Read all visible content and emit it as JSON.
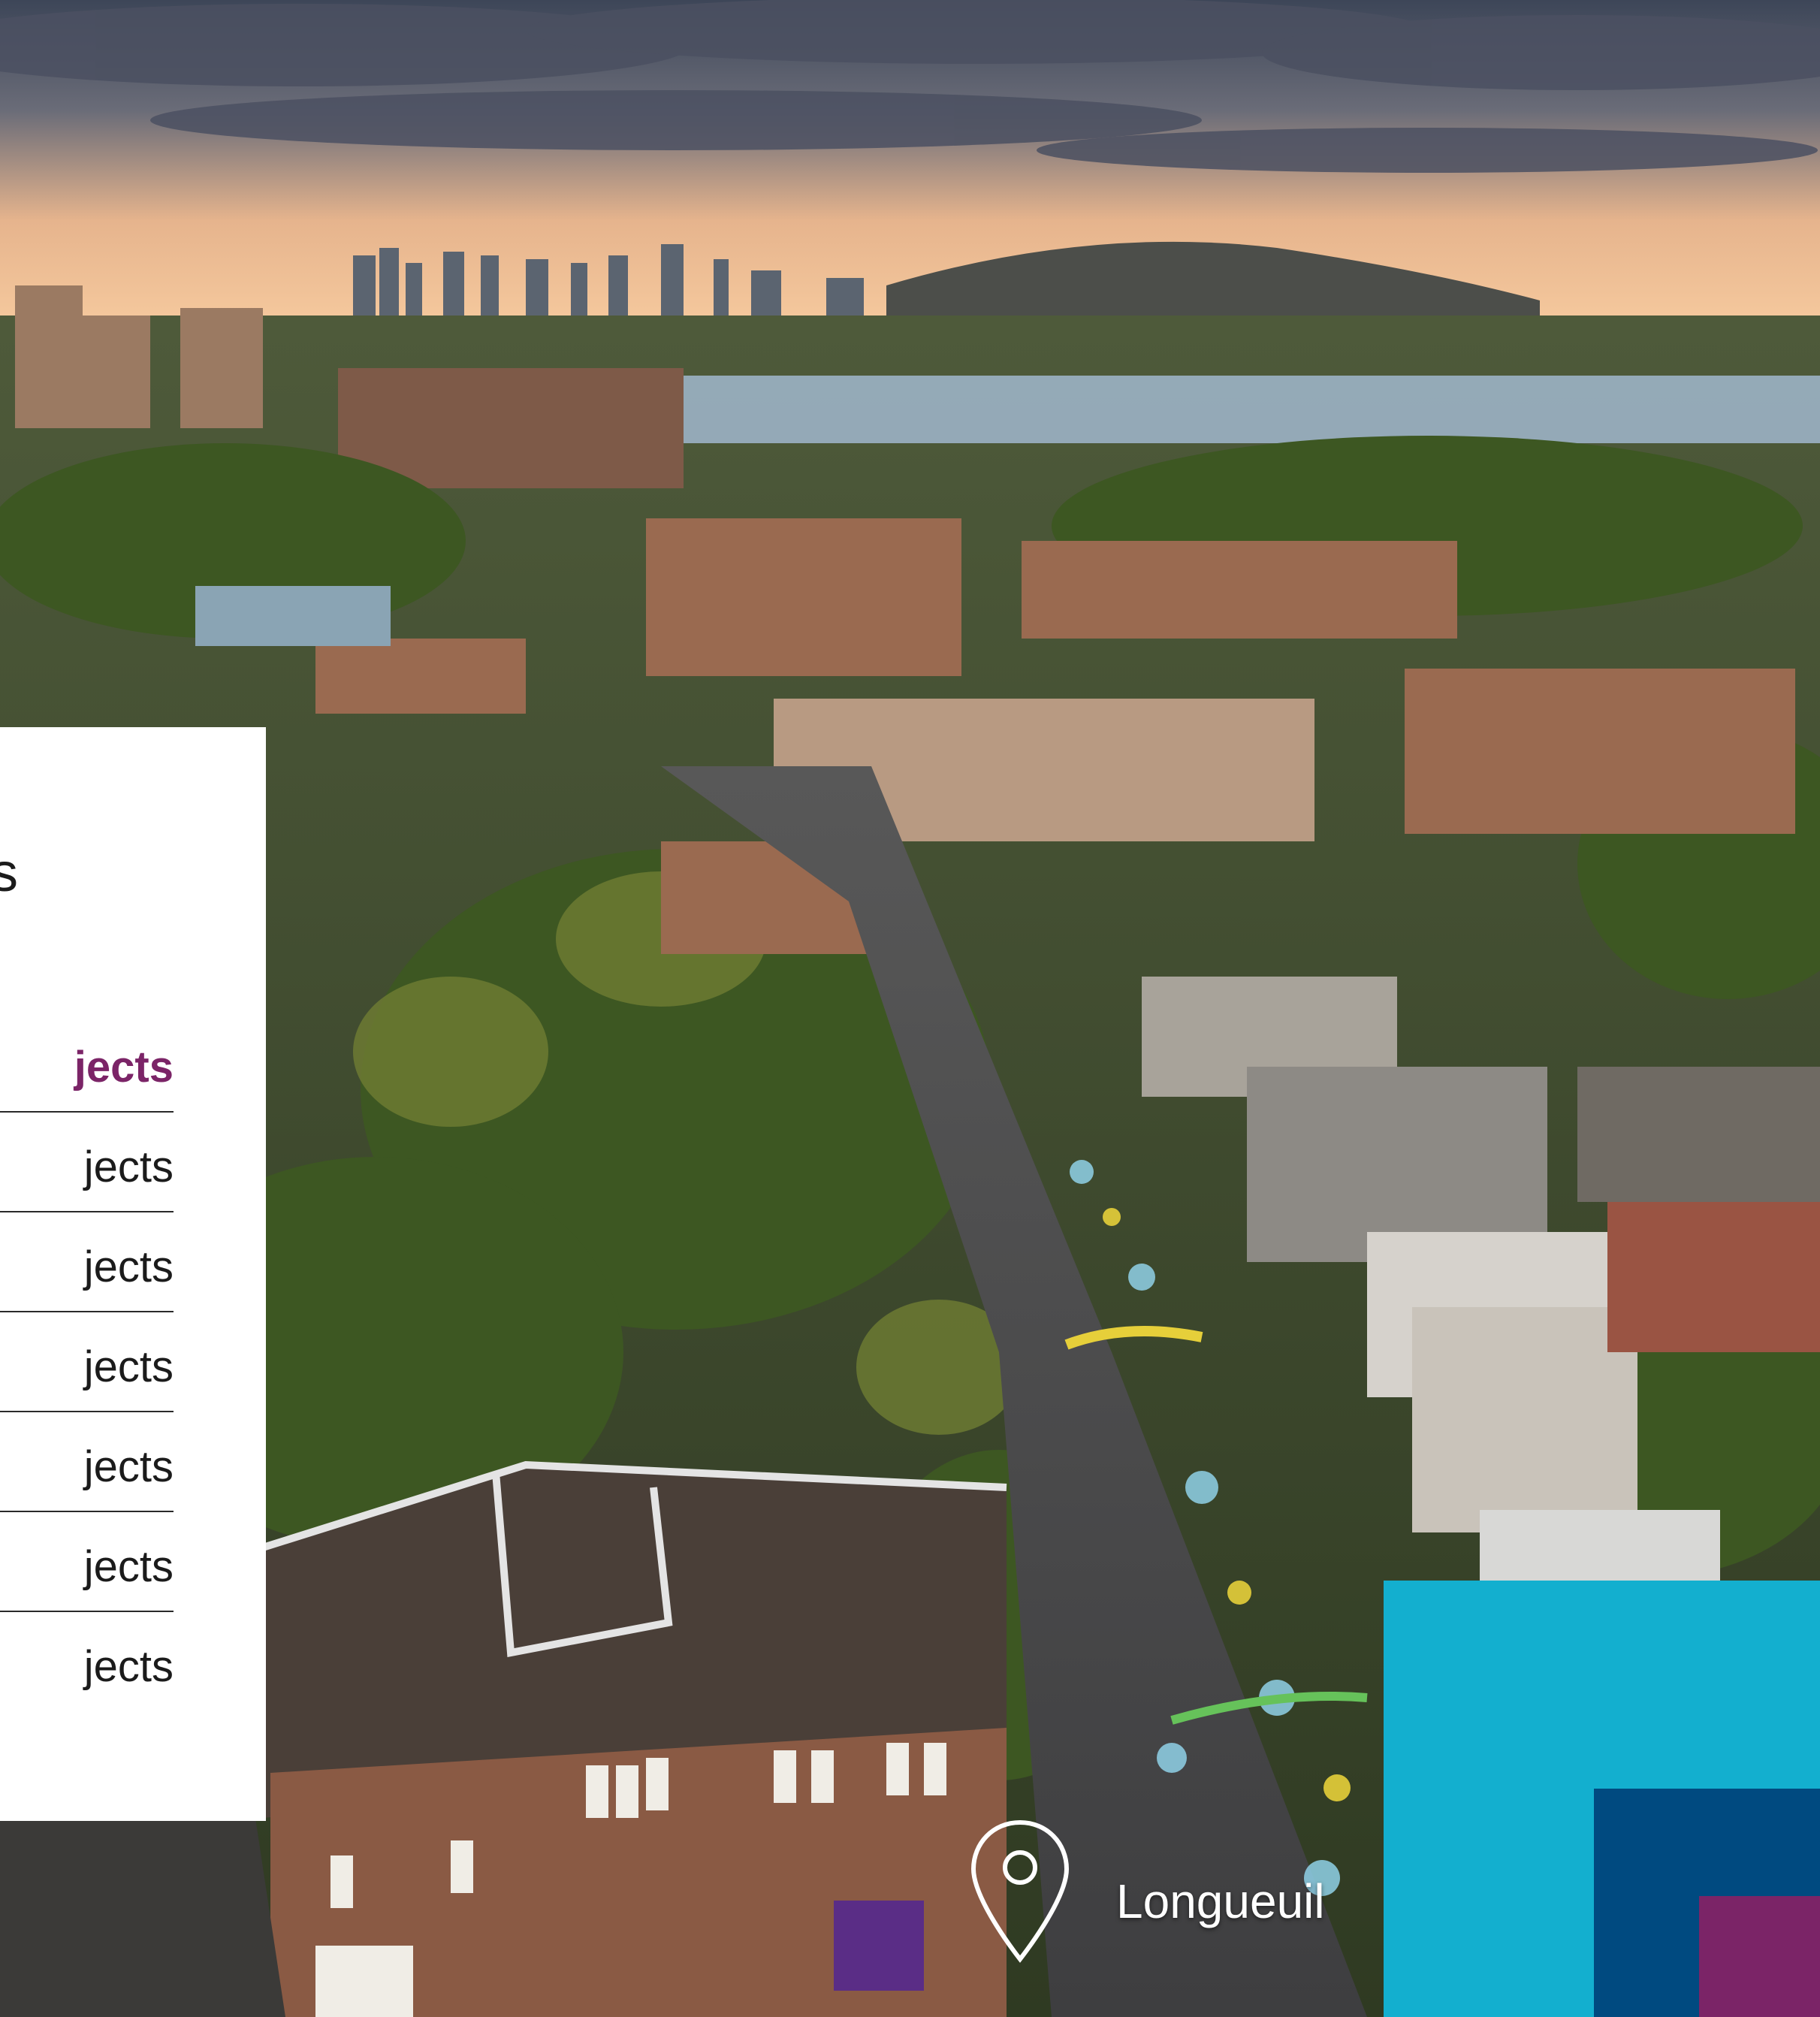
{
  "photo": {
    "subject": "aerial-city-view",
    "sky_top": "#3f4a5c",
    "sky_glow": "#f2b98a",
    "river": "#9ab0c4",
    "foliage": "#3f5a24",
    "street": "#4a4a4a"
  },
  "panel": {
    "heading_fragment": "s",
    "items": [
      {
        "label": "jects",
        "active": true
      },
      {
        "label": "jects",
        "active": false
      },
      {
        "label": "jects",
        "active": false
      },
      {
        "label": "jects",
        "active": false
      },
      {
        "label": "jects",
        "active": false
      },
      {
        "label": "jects",
        "active": false
      },
      {
        "label": "jects",
        "active": false
      }
    ],
    "active_color": "#7b2467"
  },
  "location": {
    "icon": "map-pin-icon",
    "label": "Longueuil"
  },
  "brand_blocks": {
    "cyan": "#13afcf",
    "navy": "#004a80",
    "purple": "#7b2467"
  }
}
